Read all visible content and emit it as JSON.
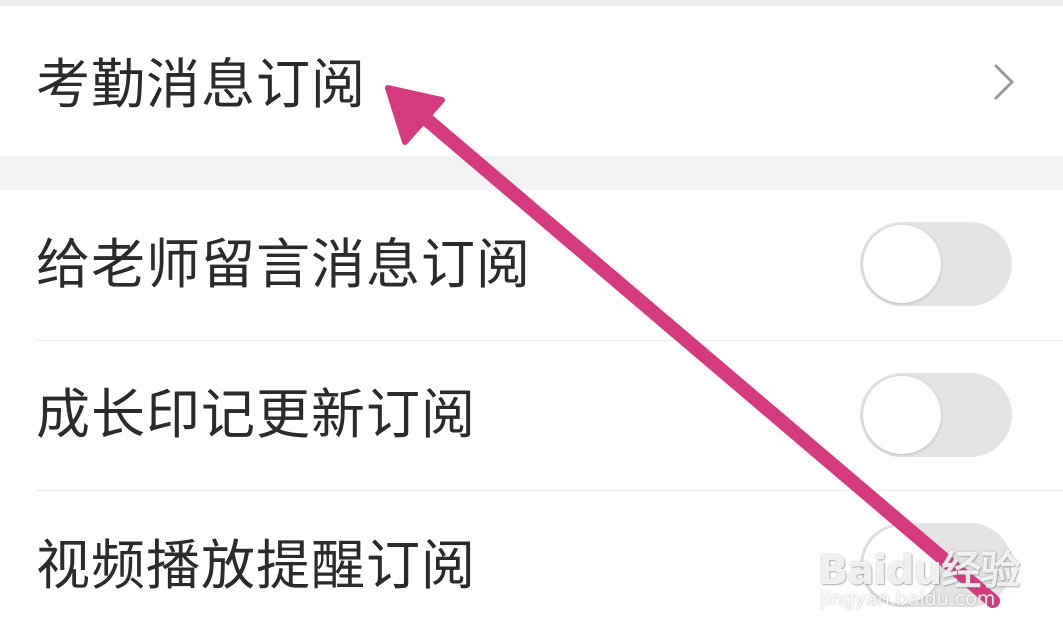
{
  "section1": {
    "items": [
      {
        "label": "考勤消息订阅",
        "control": "chevron-right"
      }
    ]
  },
  "section2": {
    "items": [
      {
        "label": "给老师留言消息订阅",
        "control": "toggle",
        "enabled": false
      },
      {
        "label": "成长印记更新订阅",
        "control": "toggle",
        "enabled": false
      },
      {
        "label": "视频播放提醒订阅",
        "control": "toggle",
        "enabled": false
      }
    ]
  },
  "annotation": {
    "type": "arrow",
    "color": "#d63a7e"
  },
  "watermark": {
    "main": "Baidu经验",
    "sub": "jingyan.baidu.com"
  },
  "colors": {
    "background": "#f3f3f5",
    "row": "#ffffff",
    "text": "#2b2b2b",
    "toggle_off": "#e4e4e6",
    "chevron": "#999999"
  }
}
